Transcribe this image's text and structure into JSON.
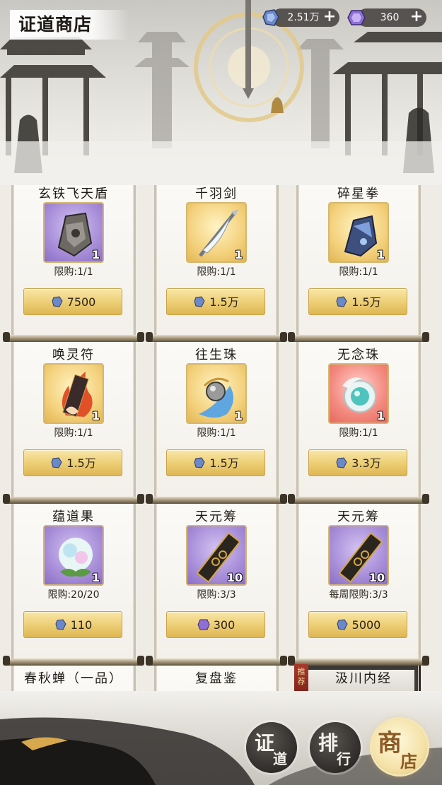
{
  "header": {
    "title": "证道商店",
    "currencies": [
      {
        "icon": "blue-spirit-stone-icon",
        "value": "2.51万"
      },
      {
        "icon": "purple-spirit-jade-icon",
        "value": "360"
      }
    ]
  },
  "items": [
    {
      "name": "玄铁飞天盾",
      "icon": "iron-shield-icon",
      "qty": "1",
      "limit": "限购:1/1",
      "price": "7500",
      "currency": "blue-spirit-stone-icon"
    },
    {
      "name": "千羽剑",
      "icon": "feather-sword-icon",
      "qty": "1",
      "limit": "限购:1/1",
      "price": "1.5万",
      "currency": "blue-spirit-stone-icon"
    },
    {
      "name": "碎星拳",
      "icon": "star-gauntlet-icon",
      "qty": "1",
      "limit": "限购:1/1",
      "price": "1.5万",
      "currency": "blue-spirit-stone-icon"
    },
    {
      "name": "唤灵符",
      "icon": "fire-talisman-icon",
      "qty": "1",
      "limit": "限购:1/1",
      "price": "1.5万",
      "currency": "blue-spirit-stone-icon"
    },
    {
      "name": "往生珠",
      "icon": "rebirth-pearl-icon",
      "qty": "1",
      "limit": "限购:1/1",
      "price": "1.5万",
      "currency": "blue-spirit-stone-icon"
    },
    {
      "name": "无念珠",
      "icon": "mindless-pearl-icon",
      "qty": "1",
      "limit": "限购:1/1",
      "price": "3.3万",
      "currency": "blue-spirit-stone-icon"
    },
    {
      "name": "蕴道果",
      "icon": "dao-fruit-icon",
      "qty": "1",
      "limit": "限购:20/20",
      "price": "110",
      "currency": "blue-spirit-stone-icon"
    },
    {
      "name": "天元筹",
      "icon": "tianyuan-token-icon",
      "qty": "10",
      "limit": "限购:3/3",
      "price": "300",
      "currency": "purple-spirit-jade-icon"
    },
    {
      "name": "天元筹",
      "icon": "tianyuan-token-icon",
      "qty": "10",
      "limit": "每周限购:3/3",
      "price": "5000",
      "currency": "blue-spirit-stone-icon"
    }
  ],
  "partial_items": [
    {
      "name": "春秋蝉（一品）"
    },
    {
      "name": "复盘鉴"
    },
    {
      "name": "汲川内经",
      "tag": "推荐"
    }
  ],
  "nav": [
    {
      "c1": "证",
      "c2": "道",
      "active": false
    },
    {
      "c1": "排",
      "c2": "行",
      "active": false
    },
    {
      "c1": "商",
      "c2": "店",
      "active": true
    }
  ],
  "colors": {
    "gold_button": "#eccd72",
    "purple_frame": "#a88ed9",
    "gold_frame": "#f4d27e",
    "red_frame": "#f38a80"
  }
}
